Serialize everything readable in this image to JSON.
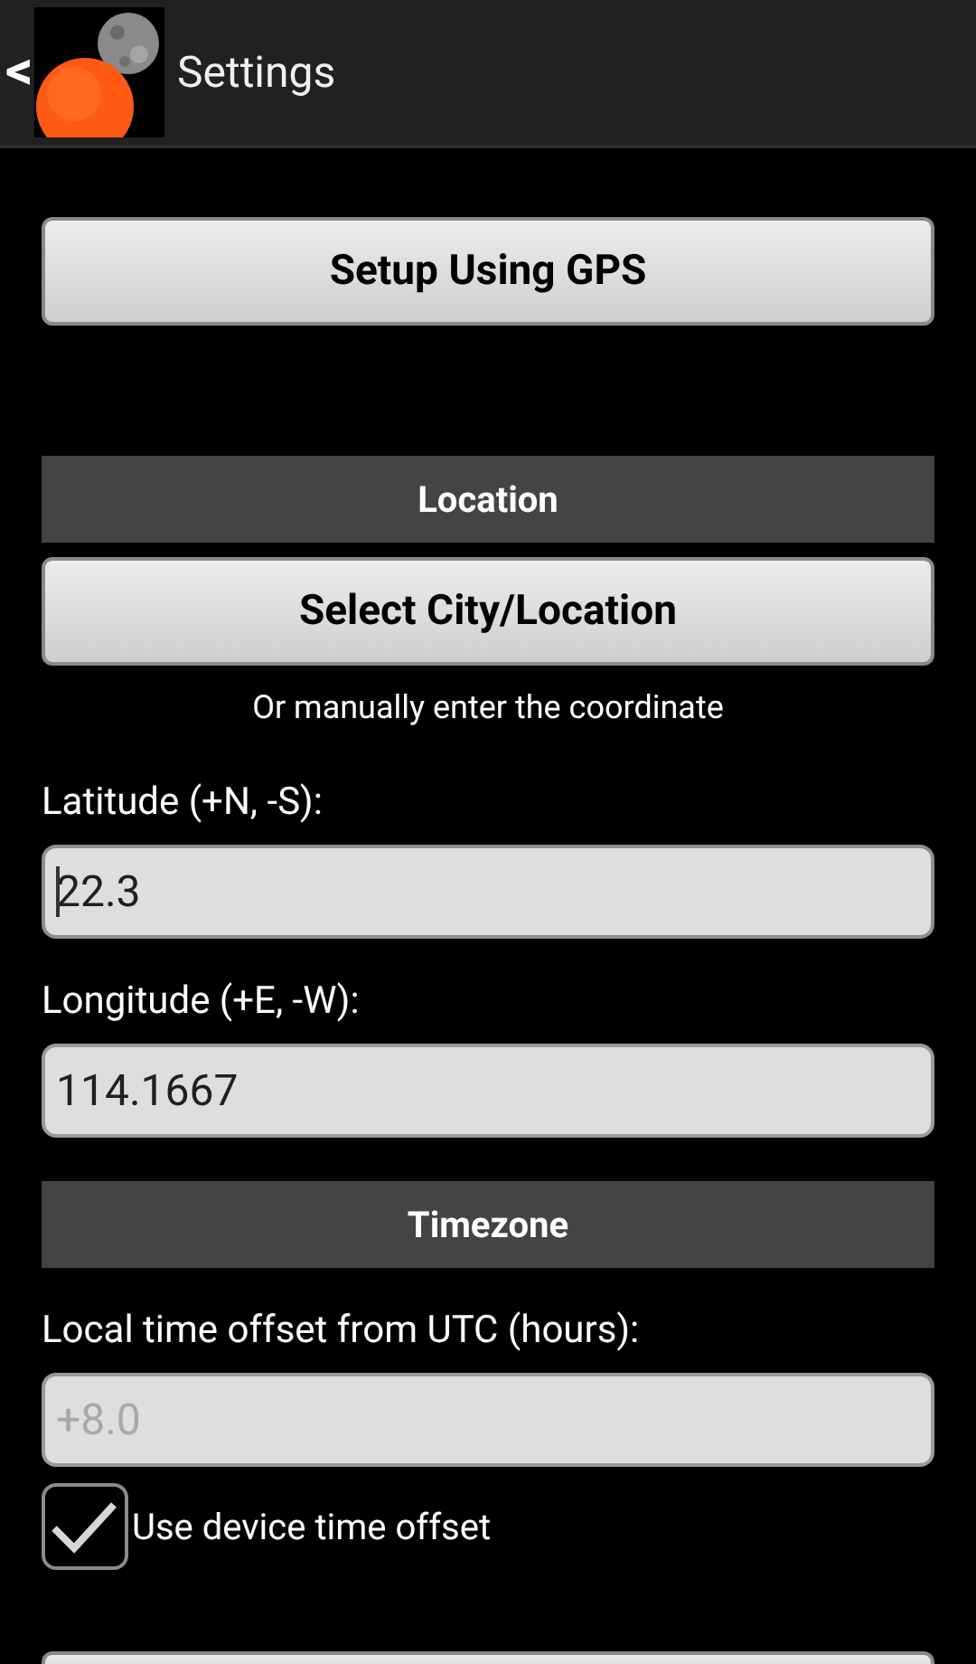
{
  "header": {
    "title": "Settings",
    "back_icon": "<"
  },
  "gps_button": "Setup Using GPS",
  "location": {
    "heading": "Location",
    "button": "Select City/Location",
    "hint": "Or manually enter the coordinate",
    "fields": [
      {
        "label": "Latitude (+N, -S):",
        "value": "22.3",
        "focused": true,
        "disabled": false
      },
      {
        "label": "Longitude (+E, -W):",
        "value": "114.1667",
        "focused": false,
        "disabled": false
      }
    ]
  },
  "timezone": {
    "heading": "Timezone",
    "fields": [
      {
        "label": "Local time offset from UTC (hours):",
        "value": "+8.0",
        "focused": false,
        "disabled": true
      }
    ],
    "checkbox": {
      "label": "Use device time offset",
      "checked": true
    }
  }
}
